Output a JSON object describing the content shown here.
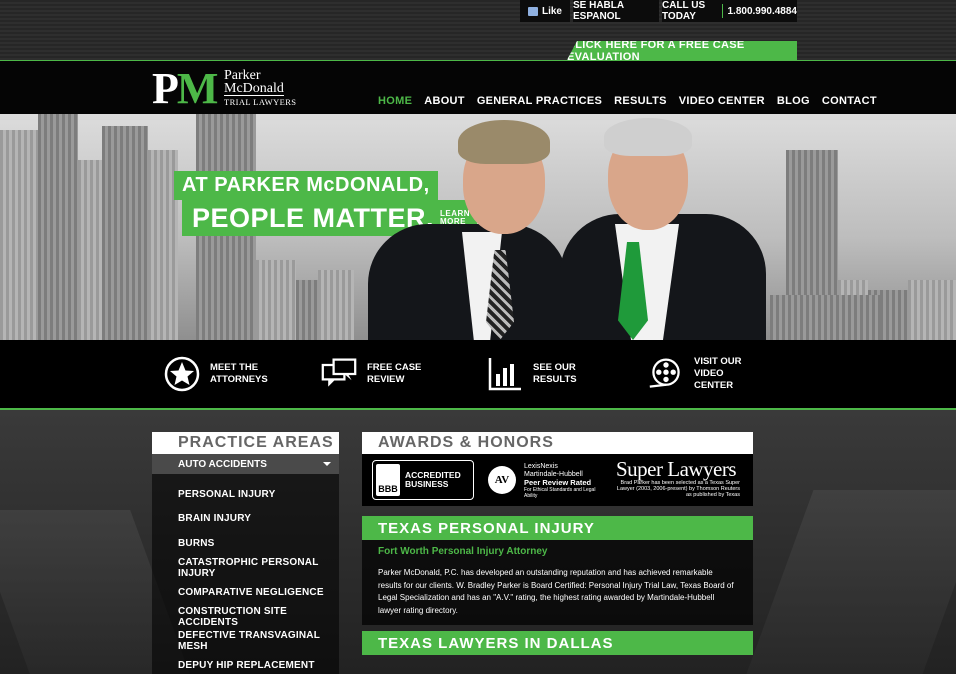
{
  "utility": {
    "like": "Like",
    "spanish": "SE HABLA ESPANOL",
    "call_label": "CALL US TODAY",
    "phone": "1.800.990.4884",
    "evaluation": "CLICK HERE FOR A FREE CASE EVALUATION"
  },
  "logo": {
    "initial_p": "P",
    "initial_m": "M",
    "name_line1": "Parker",
    "name_line2": "McDonald",
    "tagline": "TRIAL LAWYERS"
  },
  "nav": [
    "HOME",
    "ABOUT",
    "GENERAL PRACTICES",
    "RESULTS",
    "VIDEO CENTER",
    "BLOG",
    "CONTACT"
  ],
  "hero": {
    "line1": "AT PARKER McDONALD,",
    "line2": "PEOPLE MATTER.",
    "learn_line1": "LEARN",
    "learn_line2": "MORE"
  },
  "actions": [
    {
      "line1": "MEET THE",
      "line2": "ATTORNEYS",
      "icon": "star-icon"
    },
    {
      "line1": "FREE CASE",
      "line2": "REVIEW",
      "icon": "chat-icon"
    },
    {
      "line1": "SEE OUR",
      "line2": "RESULTS",
      "icon": "chart-icon"
    },
    {
      "line1": "VISIT OUR",
      "line2": "VIDEO CENTER",
      "icon": "film-reel-icon"
    }
  ],
  "practice": {
    "title": "PRACTICE AREAS",
    "active": "AUTO ACCIDENTS",
    "items": [
      "PERSONAL INJURY",
      "BRAIN INJURY",
      "BURNS",
      "CATASTROPHIC PERSONAL INJURY",
      "COMPARATIVE NEGLIGENCE",
      "CONSTRUCTION SITE ACCIDENTS",
      "DEFECTIVE TRANSVAGINAL MESH",
      "DEPUY HIP REPLACEMENT"
    ]
  },
  "awards": {
    "title": "AWARDS & HONORS",
    "bbb_logo": "BBB",
    "bbb_line1": "ACCREDITED",
    "bbb_line2": "BUSINESS",
    "av": "AV",
    "lexis_brand": "LexisNexis",
    "lexis_line1": "Martindale-Hubbell",
    "lexis_line2": "Peer Review Rated",
    "lexis_line3": "For Ethical Standards and Legal Ability",
    "superlawyers": "Super Lawyers",
    "superlawyers_note": "Brad Parker has been selected as a Texas Super Lawyer (2003, 2006-present) by Thomson Reuters as published by Texas"
  },
  "section1": {
    "title": "TEXAS PERSONAL INJURY",
    "subtitle": "Fort Worth Personal Injury Attorney",
    "body": "Parker McDonald, P.C. has developed an outstanding reputation and has achieved remarkable results for our clients. W. Bradley Parker is Board Certified: Personal Injury Trial Law, Texas Board of Legal Specialization and has an \"A.V.\" rating, the highest rating awarded by Martindale-Hubbell lawyer rating directory."
  },
  "section2": {
    "title": "TEXAS LAWYERS IN DALLAS"
  },
  "colors": {
    "brand_green": "#4db848",
    "black": "#000000"
  }
}
